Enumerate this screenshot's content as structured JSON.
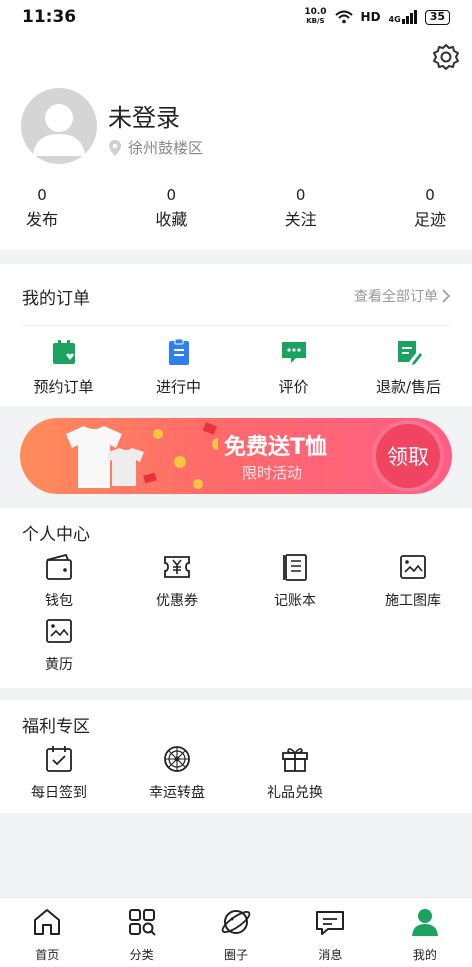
{
  "status_bar": {
    "time": "11:36",
    "netspeed_value": "10.0",
    "netspeed_unit": "KB/S",
    "hd": "HD",
    "signal": "4G",
    "battery": "35"
  },
  "profile": {
    "name": "未登录",
    "location": "徐州鼓楼区",
    "stats": [
      {
        "num": "0",
        "label": "发布"
      },
      {
        "num": "0",
        "label": "收藏"
      },
      {
        "num": "0",
        "label": "关注"
      },
      {
        "num": "0",
        "label": "足迹"
      }
    ]
  },
  "orders": {
    "title": "我的订单",
    "view_all": "查看全部订单",
    "items": [
      {
        "label": "预约订单",
        "icon": "calendar-check-icon"
      },
      {
        "label": "进行中",
        "icon": "clipboard-icon"
      },
      {
        "label": "评价",
        "icon": "chat-bubble-icon"
      },
      {
        "label": "退款/售后",
        "icon": "refund-edit-icon"
      }
    ]
  },
  "banner": {
    "main": "免费送T恤",
    "sub": "限时活动",
    "button": "领取"
  },
  "personal": {
    "title": "个人中心",
    "items": [
      {
        "label": "钱包",
        "icon": "wallet-icon"
      },
      {
        "label": "优惠券",
        "icon": "coupon-icon"
      },
      {
        "label": "记账本",
        "icon": "ledger-icon"
      },
      {
        "label": "施工图库",
        "icon": "gallery-icon"
      },
      {
        "label": "黄历",
        "icon": "almanac-icon"
      }
    ]
  },
  "welfare": {
    "title": "福利专区",
    "items": [
      {
        "label": "每日签到",
        "icon": "daily-checkin-icon"
      },
      {
        "label": "幸运转盘",
        "icon": "lucky-wheel-icon"
      },
      {
        "label": "礼品兑换",
        "icon": "gift-icon"
      }
    ]
  },
  "nav": [
    {
      "label": "首页",
      "icon": "home-icon"
    },
    {
      "label": "分类",
      "icon": "category-icon"
    },
    {
      "label": "圈子",
      "icon": "planet-icon"
    },
    {
      "label": "消息",
      "icon": "message-icon"
    },
    {
      "label": "我的",
      "icon": "profile-icon"
    }
  ],
  "colors": {
    "accent": "#1aa260",
    "blue": "#2f7ff0",
    "banner_start": "#ff8c5a",
    "banner_end": "#ff5d85",
    "button": "#f04462"
  }
}
